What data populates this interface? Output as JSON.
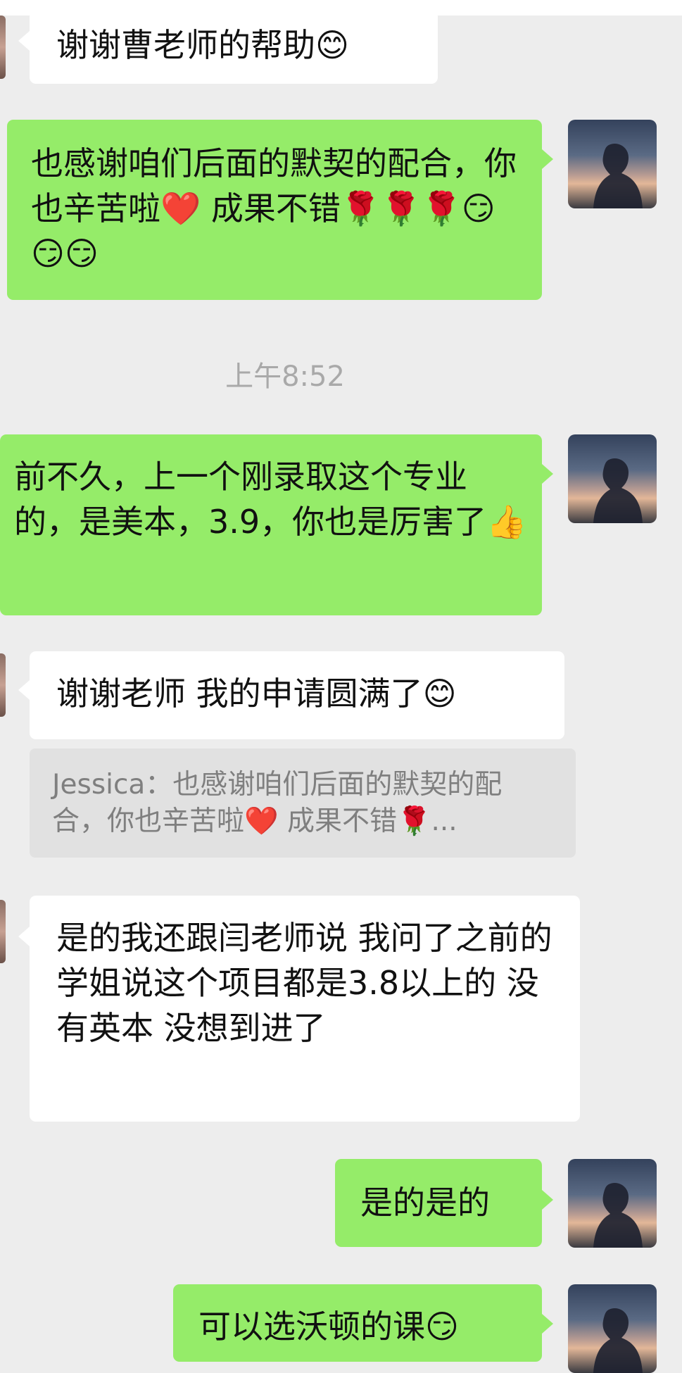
{
  "timestamp": "上午8:52",
  "messages": [
    {
      "side": "left",
      "text": "谢谢曹老师的帮助😊"
    },
    {
      "side": "right",
      "text": "也感谢咱们后面的默契的配合，你也辛苦啦❤️ 成果不错🌹🌹🌹😏😏😏"
    },
    {
      "side": "right",
      "text": "前不久，上一个刚录取这个专业的，是美本，3.9，你也是厉害了👍"
    },
    {
      "side": "left",
      "text": "谢谢老师 我的申请圆满了😊"
    },
    {
      "side": "left",
      "text": "是的我还跟闫老师说 我问了之前的学姐说这个项目都是3.8以上的 没有英本 没想到进了"
    },
    {
      "side": "right",
      "text": "是的是的"
    },
    {
      "side": "right",
      "text": "可以选沃顿的课😏"
    }
  ],
  "quote": {
    "text": "Jessica：也感谢咱们后面的默契的配合，你也辛苦啦❤️ 成果不错🌹..."
  },
  "icons": {
    "avatar": "user-avatar-silhouette",
    "left_avatar": "contact-avatar"
  }
}
